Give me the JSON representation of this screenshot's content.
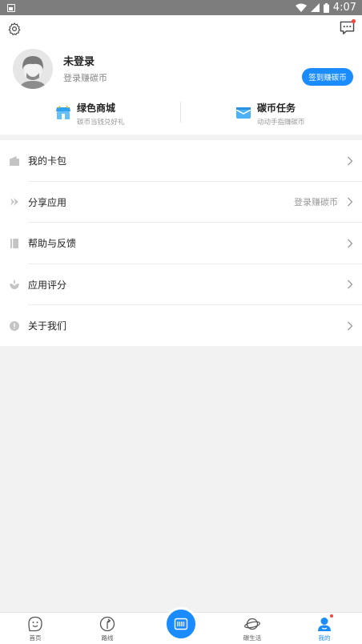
{
  "status_bar": {
    "time": "4:07"
  },
  "profile": {
    "name": "未登录",
    "subtitle": "登录赚碳币",
    "signin_button": "签到赚碳币"
  },
  "quick_actions": [
    {
      "title": "绿色商城",
      "subtitle": "碳币当钱兑好礼",
      "icon": "shop-icon"
    },
    {
      "title": "碳币任务",
      "subtitle": "动动手指赚碳币",
      "icon": "task-icon"
    }
  ],
  "menu": [
    {
      "label": "我的卡包",
      "extra": "",
      "icon": "wallet-icon"
    },
    {
      "label": "分享应用",
      "extra": "登录赚碳币",
      "icon": "share-icon"
    },
    {
      "label": "帮助与反馈",
      "extra": "",
      "icon": "help-icon"
    },
    {
      "label": "应用评分",
      "extra": "",
      "icon": "rating-icon"
    },
    {
      "label": "关于我们",
      "extra": "",
      "icon": "info-icon"
    }
  ],
  "bottom_nav": [
    {
      "label": "首页",
      "icon": "home-face-icon"
    },
    {
      "label": "路线",
      "icon": "route-icon"
    },
    {
      "label": "碳生活",
      "icon": "planet-icon"
    },
    {
      "label": "我的",
      "icon": "profile-icon",
      "active": true
    }
  ],
  "colors": {
    "accent": "#1a8cff",
    "badge": "#f5453d",
    "background": "#f2f2f2"
  }
}
